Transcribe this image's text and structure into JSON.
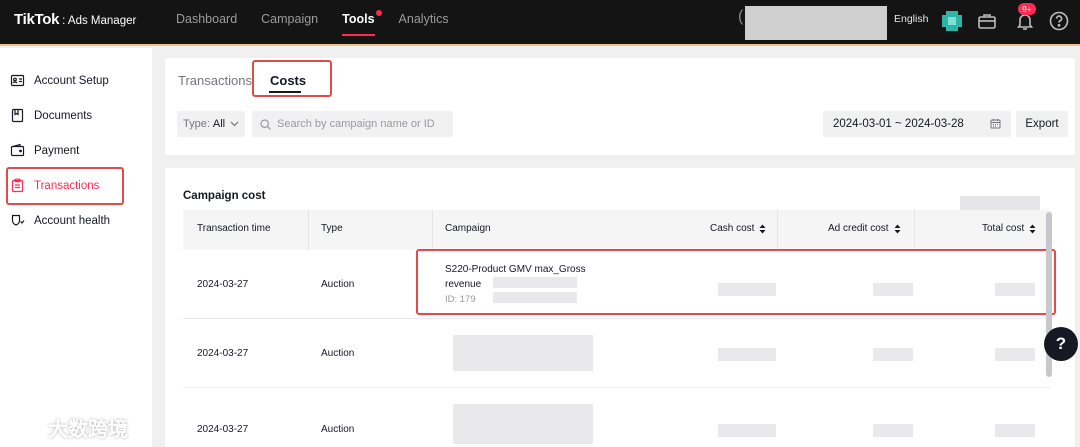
{
  "header": {
    "logo_main": "TikTok",
    "logo_sub": ": Ads Manager",
    "nav": [
      "Dashboard",
      "Campaign",
      "Tools",
      "Analytics"
    ],
    "active_nav": "Tools",
    "language": "English",
    "notification_badge": "9+",
    "accent_color": "#fe2c55"
  },
  "sidebar": {
    "items": [
      {
        "label": "Account Setup",
        "icon": "id-card-icon"
      },
      {
        "label": "Documents",
        "icon": "document-icon"
      },
      {
        "label": "Payment",
        "icon": "wallet-icon"
      },
      {
        "label": "Transactions",
        "icon": "clipboard-icon",
        "active": true
      },
      {
        "label": "Account health",
        "icon": "shield-icon"
      }
    ]
  },
  "tabs": {
    "transactions": "Transactions",
    "costs": "Costs",
    "active": "Costs"
  },
  "filters": {
    "type_label": "Type:",
    "type_value": "All",
    "search_placeholder": "Search by campaign name or ID",
    "date_range": "2024-03-01 ~ 2024-03-28",
    "export_label": "Export"
  },
  "campaign_cost": {
    "title": "Campaign cost",
    "columns": [
      "Transaction time",
      "Type",
      "Campaign",
      "Cash cost",
      "Ad credit cost",
      "Total cost"
    ],
    "rows": [
      {
        "time": "2024-03-27",
        "type": "Auction",
        "campaign_line1": "S220-Product GMV max_Gross",
        "campaign_line2": "revenue",
        "campaign_id": "ID: 179"
      },
      {
        "time": "2024-03-27",
        "type": "Auction"
      },
      {
        "time": "2024-03-27",
        "type": "Auction"
      }
    ]
  },
  "help_label": "?",
  "watermark": "大数跨境"
}
